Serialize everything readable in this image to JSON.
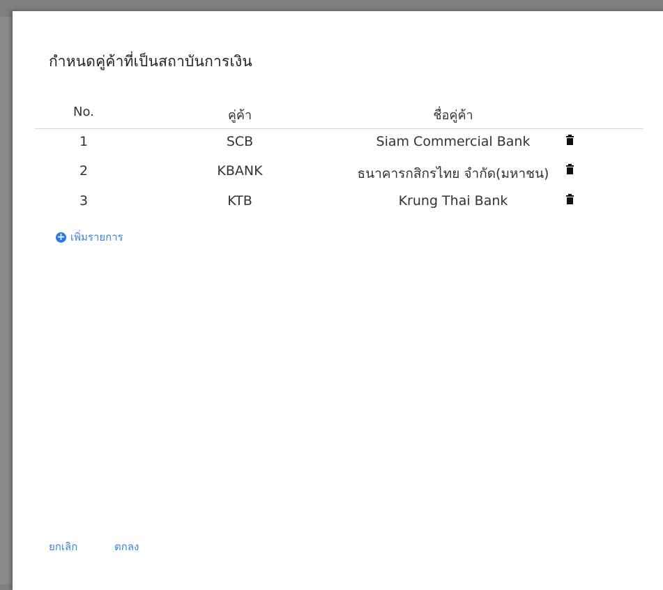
{
  "dialog": {
    "title": "กำหนดคู่ค้าที่เป็นสถาบันการเงิน"
  },
  "table": {
    "headers": {
      "no": "No.",
      "partner": "คู่ค้า",
      "partner_name": "ชื่อคู่ค้า"
    },
    "rows": [
      {
        "no": "1",
        "code": "SCB",
        "name": "Siam Commercial Bank"
      },
      {
        "no": "2",
        "code": "KBANK",
        "name": "ธนาคารกสิกรไทย จำกัด(มหาชน)"
      },
      {
        "no": "3",
        "code": "KTB",
        "name": "Krung Thai Bank"
      }
    ],
    "row_action_icon": "trash-icon"
  },
  "add_item": {
    "label": "เพิ่มรายการ",
    "icon": "plus-circle-icon"
  },
  "footer": {
    "cancel_label": "ยกเลิก",
    "ok_label": "ตกลง"
  },
  "colors": {
    "accent": "#3b82d8",
    "overlay": "#7f7f7f",
    "dialog_bg": "#ffffff"
  }
}
